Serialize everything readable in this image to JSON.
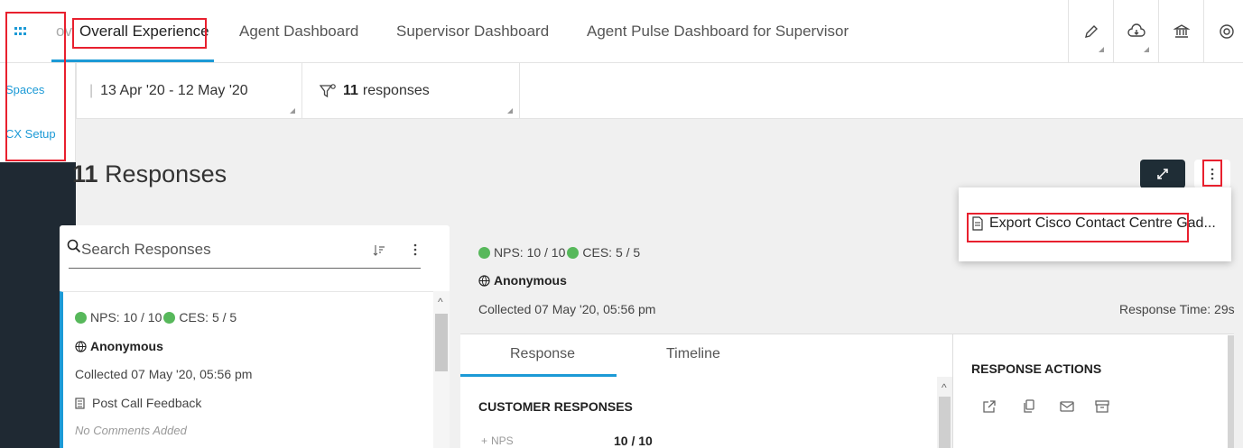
{
  "topbar": {
    "tab_cut_prefix": "ov",
    "tabs": [
      {
        "label": "Overall Experience",
        "active": true
      },
      {
        "label": "Agent Dashboard",
        "active": false
      },
      {
        "label": "Supervisor Dashboard",
        "active": false
      },
      {
        "label": "Agent Pulse Dashboard for Supervisor",
        "active": false
      }
    ],
    "tools": [
      "pencil-icon",
      "cloud-download-icon",
      "bank-icon",
      "at-icon"
    ]
  },
  "sidebar": {
    "items": [
      {
        "label": "Spaces"
      },
      {
        "label": "CX Setup"
      }
    ]
  },
  "filters": {
    "date_range": "13 Apr '20 - 12 May '20",
    "responses_count": "11",
    "responses_label": "responses"
  },
  "main": {
    "title_count": "11",
    "title_label": "Responses",
    "export_label": "Export Cisco Contact Centre Gad..."
  },
  "list": {
    "search_placeholder": "Search Responses",
    "card": {
      "nps": "NPS: 10 / 10",
      "ces": "CES: 5 / 5",
      "user": "Anonymous",
      "collected": "Collected 07 May '20, 05:56 pm",
      "survey": "Post Call Feedback",
      "comments": "No Comments Added"
    }
  },
  "detail": {
    "nps": "NPS: 10 / 10",
    "ces": "CES: 5 / 5",
    "user": "Anonymous",
    "collected": "Collected 07 May '20, 05:56 pm",
    "response_time": "Response Time: 29s",
    "tabs": [
      {
        "label": "Response",
        "active": true
      },
      {
        "label": "Timeline",
        "active": false
      }
    ],
    "customer_responses_heading": "CUSTOMER RESPONSES",
    "nps_row_label": "NPS",
    "nps_row_value": "10 / 10",
    "actions_heading": "RESPONSE ACTIONS"
  },
  "colors": {
    "accent": "#1c9ad6",
    "highlight": "#e8202e",
    "sidebar": "#1f2933",
    "status_green": "#57b85b"
  }
}
